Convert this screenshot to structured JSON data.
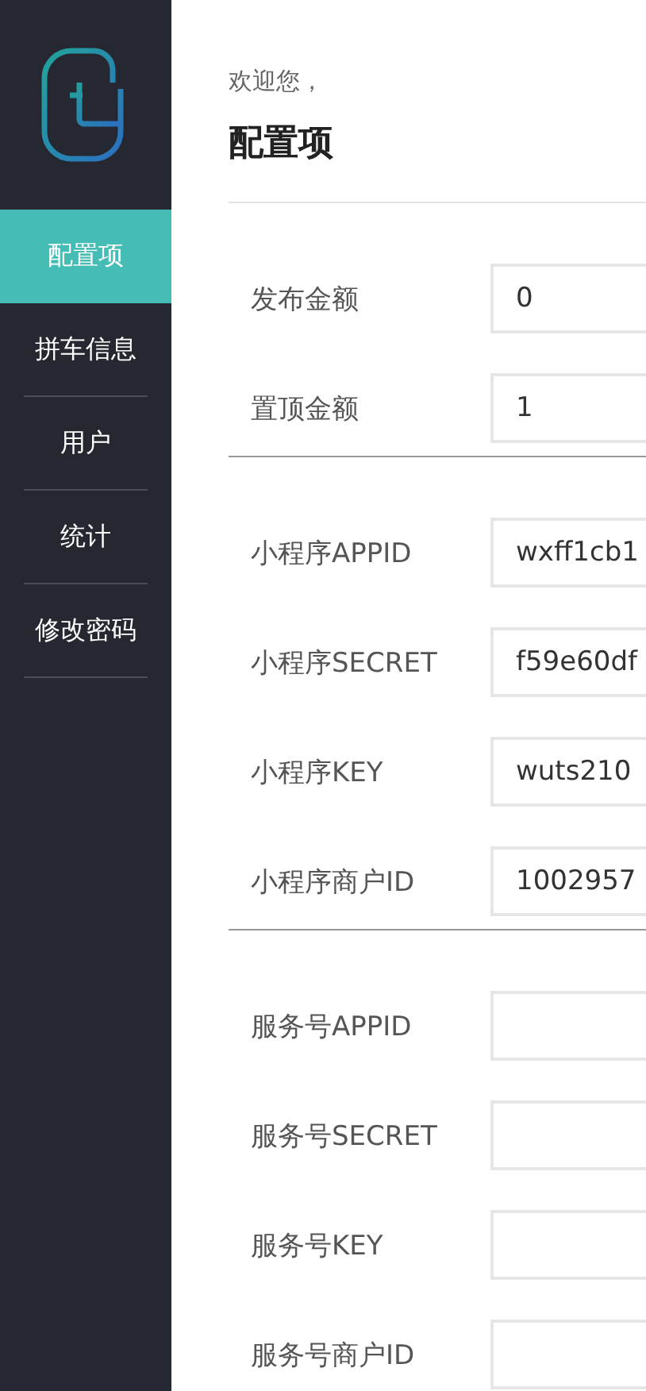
{
  "sidebar": {
    "items": [
      {
        "label": "配置项",
        "selected": true
      },
      {
        "label": "拼车信息",
        "selected": false
      },
      {
        "label": "用户",
        "selected": false
      },
      {
        "label": "统计",
        "selected": false
      },
      {
        "label": "修改密码",
        "selected": false
      }
    ]
  },
  "header": {
    "greeting": "欢迎您，",
    "title": "配置项"
  },
  "sections": [
    {
      "fields": [
        {
          "label": "发布金额",
          "value": "0"
        },
        {
          "label": "置顶金额",
          "value": "1"
        }
      ]
    },
    {
      "fields": [
        {
          "label": "小程序APPID",
          "value": "wxff1cb1"
        },
        {
          "label": "小程序SECRET",
          "value": "f59e60df"
        },
        {
          "label": "小程序KEY",
          "value": "wuts210"
        },
        {
          "label": "小程序商户ID",
          "value": "1002957"
        }
      ]
    },
    {
      "fields": [
        {
          "label": "服务号APPID"
        },
        {
          "label": "服务号SECRET"
        },
        {
          "label": "服务号KEY"
        },
        {
          "label": "服务号商户ID"
        }
      ]
    }
  ]
}
